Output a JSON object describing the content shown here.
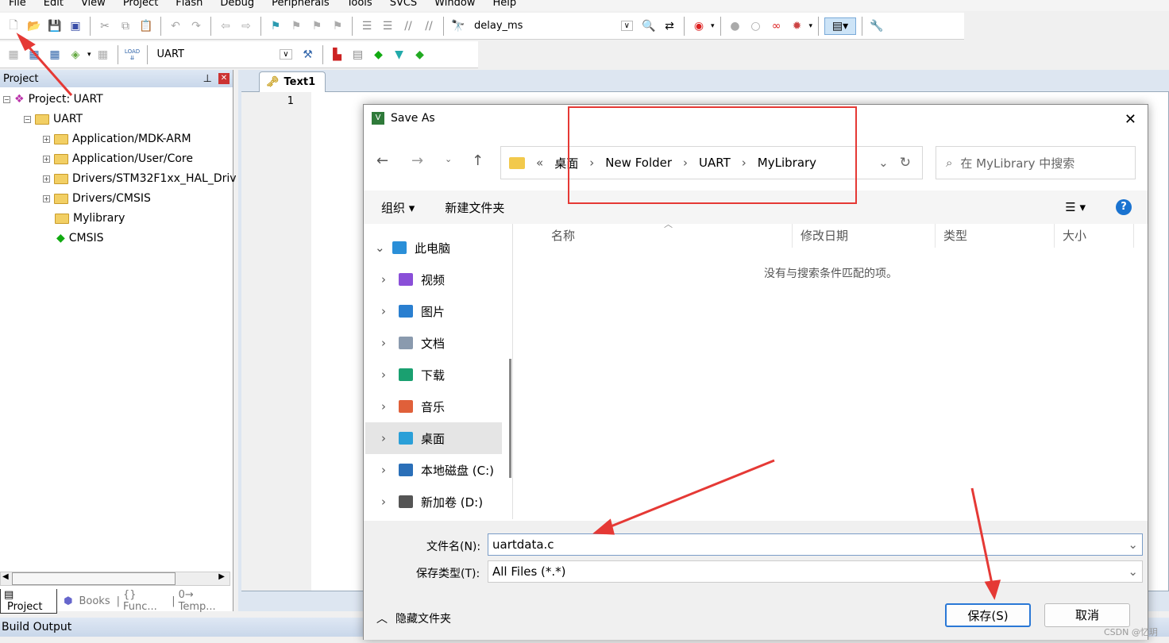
{
  "menu": [
    "File",
    "Edit",
    "View",
    "Project",
    "Flash",
    "Debug",
    "Peripherals",
    "Tools",
    "SVCS",
    "Window",
    "Help"
  ],
  "toolbar": {
    "find_combo": "delay_ms",
    "target_combo": "UART",
    "load_label": "LOAD"
  },
  "project_panel": {
    "title": "Project",
    "root": "Project: UART",
    "target": "UART",
    "groups": [
      "Application/MDK-ARM",
      "Application/User/Core",
      "Drivers/STM32F1xx_HAL_Driv",
      "Drivers/CMSIS",
      "Mylibrary",
      "CMSIS"
    ],
    "tabs": [
      "Project",
      "Books",
      "{} Func...",
      "0→ Temp..."
    ]
  },
  "build_output": "Build Output",
  "editor": {
    "tab": "Text1",
    "line_number": "1"
  },
  "dialog": {
    "title": "Save As",
    "breadcrumb": [
      "«",
      "桌面",
      "New Folder",
      "UART",
      "MyLibrary"
    ],
    "search_placeholder": "在 MyLibrary 中搜索",
    "organize": "组织 ▾",
    "new_folder": "新建文件夹",
    "nav": [
      {
        "label": "此电脑",
        "icon": "pc-icon",
        "color": "#2a8fd8"
      },
      {
        "label": "视频",
        "icon": "video-icon",
        "color": "#8a4fd8"
      },
      {
        "label": "图片",
        "icon": "picture-icon",
        "color": "#2a7fd0"
      },
      {
        "label": "文档",
        "icon": "document-icon",
        "color": "#8a9aae"
      },
      {
        "label": "下载",
        "icon": "download-icon",
        "color": "#1aa070"
      },
      {
        "label": "音乐",
        "icon": "music-icon",
        "color": "#e0603a"
      },
      {
        "label": "桌面",
        "icon": "desktop-icon",
        "color": "#2a9fd8"
      },
      {
        "label": "本地磁盘 (C:)",
        "icon": "disk-icon",
        "color": "#2a6fb8"
      },
      {
        "label": "新加卷 (D:)",
        "icon": "drive-icon",
        "color": "#555"
      }
    ],
    "columns": [
      "名称",
      "修改日期",
      "类型",
      "大小"
    ],
    "empty_message": "没有与搜索条件匹配的项。",
    "filename_label": "文件名(N):",
    "filename_value": "uartdata.c",
    "filetype_label": "保存类型(T):",
    "filetype_value": "All Files (*.*)",
    "hide_folders": "隐藏文件夹",
    "save": "保存(S)",
    "cancel": "取消"
  },
  "watermark": "CSDN @忆玥",
  "annotation_color": "#e53935"
}
